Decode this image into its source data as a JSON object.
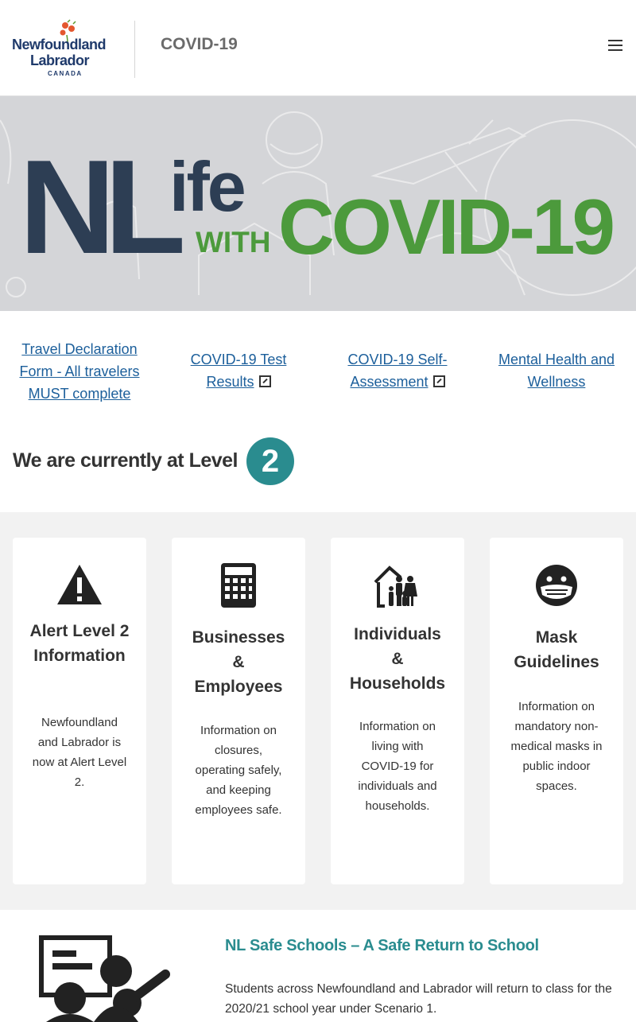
{
  "header": {
    "logo_line1": "Newfoundland",
    "logo_line2": "Labrador",
    "logo_line3": "CANADA",
    "title": "COVID-19",
    "menu_icon": "hamburger-menu-icon"
  },
  "hero": {
    "nl": "NL",
    "ife": "ife",
    "with": "WITH",
    "covid": "COVID-19"
  },
  "quicklinks": [
    {
      "label": "Travel Declaration Form - All travelers MUST complete",
      "external": false
    },
    {
      "label": "COVID-19 Test Results",
      "external": true
    },
    {
      "label": "COVID-19 Self-Assessment",
      "external": true
    },
    {
      "label": "Mental Health and Wellness",
      "external": false
    }
  ],
  "level": {
    "text": "We are currently at Level",
    "value": "2",
    "color": "#2a8c8f"
  },
  "cards": [
    {
      "title": "Alert Level 2 Information",
      "desc": "Newfoundland and Labrador is now at Alert Level 2.",
      "icon": "warning-triangle-icon"
    },
    {
      "title": "Businesses & Employees",
      "desc": "Information on closures, operating safely, and keeping employees safe.",
      "icon": "calculator-icon"
    },
    {
      "title": "Individuals & Households",
      "desc": "Information on living with COVID-19 for individuals and households.",
      "icon": "family-house-icon"
    },
    {
      "title": "Mask Guidelines",
      "desc": "Information on mandatory non-medical masks in public indoor spaces.",
      "icon": "masked-face-icon"
    }
  ],
  "schools": {
    "title": "NL Safe Schools – A Safe Return to School",
    "text": "Students across Newfoundland and Labrador will return to class for the 2020/21 school year under Scenario 1.",
    "icon": "classroom-icon"
  },
  "colors": {
    "brand_navy": "#2d3e54",
    "brand_green": "#4c9a3c",
    "teal": "#2a8c8f",
    "link": "#1c5f9b"
  }
}
